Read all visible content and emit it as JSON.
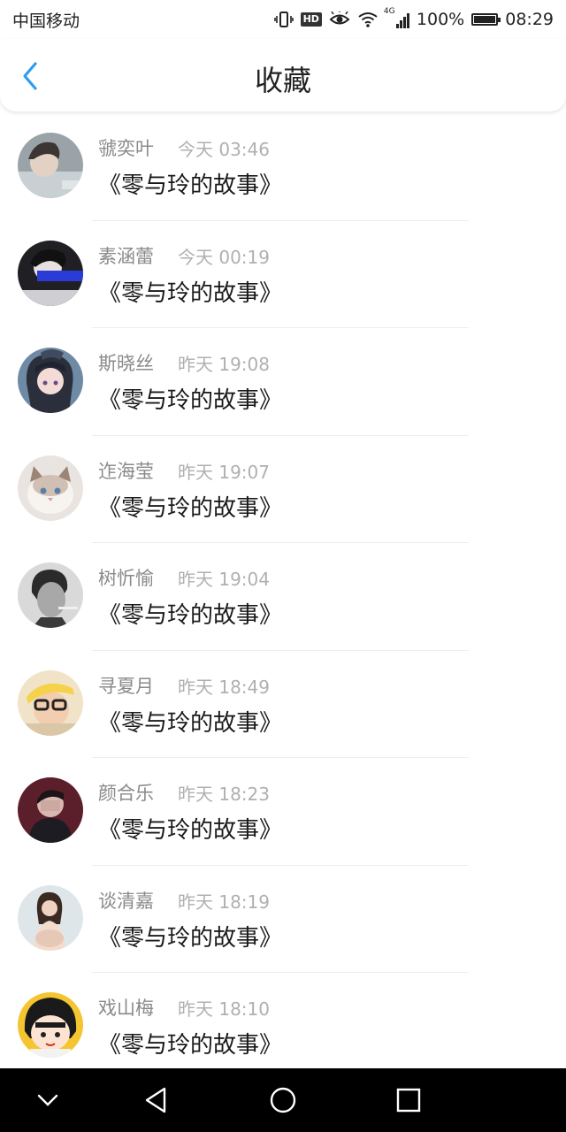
{
  "status_bar": {
    "carrier": "中国移动",
    "network": "4G",
    "hd_badge": "HD",
    "battery_text": "100%",
    "battery_level": 1.0,
    "time": "08:29",
    "icons": [
      "vibrate-icon",
      "hd-icon",
      "eye-comfort-icon",
      "wifi-icon",
      "signal-icon",
      "battery-icon"
    ]
  },
  "header": {
    "title": "收藏",
    "back_icon": "chevron-left-icon",
    "accent_color": "#2d9cf2"
  },
  "favorites": [
    {
      "name": "虢奕叶",
      "time": "今天 03:46",
      "title": "《零与玲的故事》"
    },
    {
      "name": "素涵蕾",
      "time": "今天 00:19",
      "title": "《零与玲的故事》"
    },
    {
      "name": "斯晓丝",
      "time": "昨天 19:08",
      "title": "《零与玲的故事》"
    },
    {
      "name": "迮海莹",
      "time": "昨天 19:07",
      "title": "《零与玲的故事》"
    },
    {
      "name": "树忻愉",
      "time": "昨天 19:04",
      "title": "《零与玲的故事》"
    },
    {
      "name": "寻夏月",
      "time": "昨天 18:49",
      "title": "《零与玲的故事》"
    },
    {
      "name": "颜合乐",
      "time": "昨天 18:23",
      "title": "《零与玲的故事》"
    },
    {
      "name": "谈清嘉",
      "time": "昨天 18:19",
      "title": "《零与玲的故事》"
    },
    {
      "name": "戏山梅",
      "time": "昨天 18:10",
      "title": "《零与玲的故事》"
    }
  ],
  "nav_bar": {
    "buttons": [
      "collapse-icon",
      "back-triangle-icon",
      "home-circle-icon",
      "recents-square-icon"
    ]
  }
}
